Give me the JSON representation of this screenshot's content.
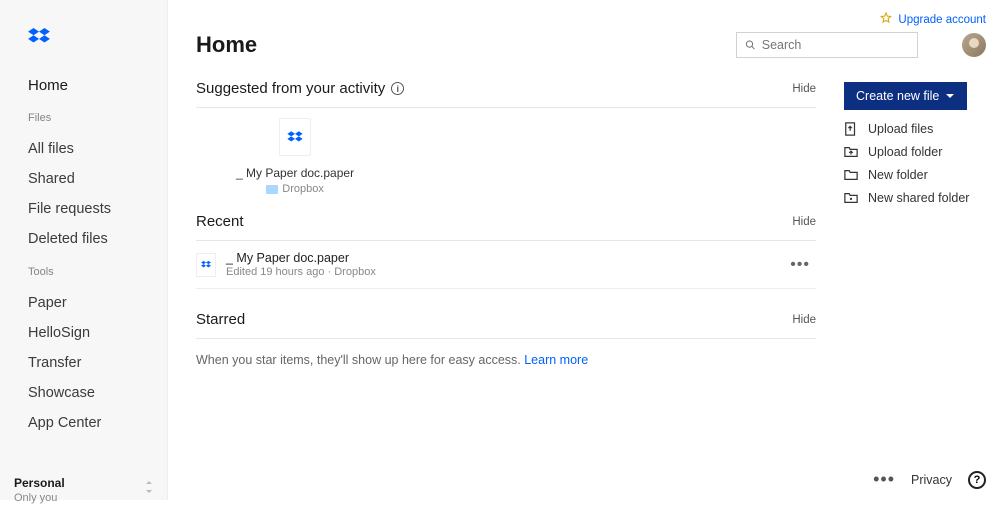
{
  "brand": "Dropbox",
  "upgrade_label": "Upgrade account",
  "sidebar": {
    "home_label": "Home",
    "files_section_label": "Files",
    "files_items": [
      "All files",
      "Shared",
      "File requests",
      "Deleted files"
    ],
    "tools_section_label": "Tools",
    "tools_items": [
      "Paper",
      "HelloSign",
      "Transfer",
      "Showcase",
      "App Center"
    ],
    "account_name": "Personal",
    "account_sub": "Only you"
  },
  "page_title": "Home",
  "search": {
    "placeholder": "Search"
  },
  "sections": {
    "suggested": {
      "title": "Suggested from your activity",
      "hide": "Hide",
      "item": {
        "name": "_ My Paper doc.paper",
        "location": "Dropbox"
      }
    },
    "recent": {
      "title": "Recent",
      "hide": "Hide",
      "item": {
        "name": "_ My Paper doc.paper",
        "meta": "Edited 19 hours ago · Dropbox"
      }
    },
    "starred": {
      "title": "Starred",
      "hide": "Hide",
      "empty_msg": "When you star items, they'll show up here for easy access. ",
      "learn_more": "Learn more"
    }
  },
  "actions": {
    "create_button": "Create new file",
    "items": [
      "Upload files",
      "Upload folder",
      "New folder",
      "New shared folder"
    ]
  },
  "footer": {
    "privacy": "Privacy"
  }
}
